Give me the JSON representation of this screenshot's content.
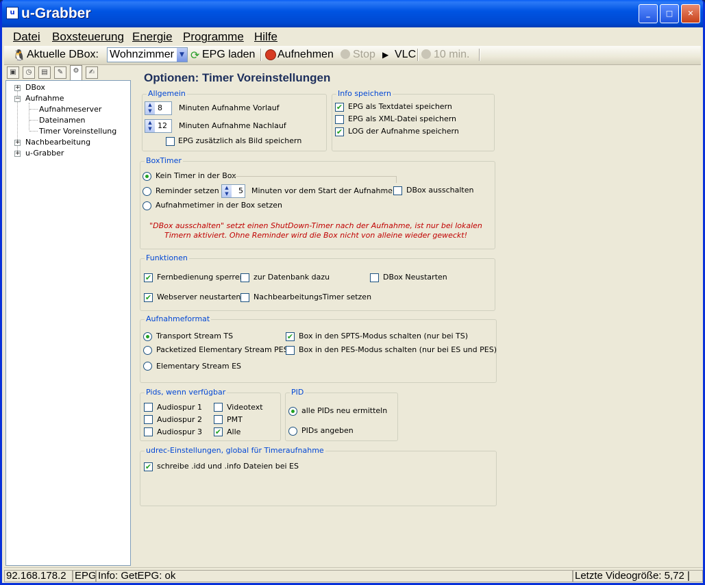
{
  "window": {
    "title": "u-Grabber"
  },
  "menu": [
    "Datei",
    "Boxsteuerung",
    "Energie",
    "Programme",
    "Hilfe"
  ],
  "toolbar": {
    "dbox_label": "Aktuelle DBox:",
    "dbox_value": "Wohnzimmer",
    "epg_load": "EPG laden",
    "record": "Aufnehmen",
    "stop": "Stop",
    "vlc": "VLC",
    "ten_min": "10 min."
  },
  "tree": {
    "dbox": "DBox",
    "aufnahme": "Aufnahme",
    "aufnahmeserver": "Aufnahmeserver",
    "dateinamen": "Dateinamen",
    "timer_voreinstellung": "Timer Voreinstellung",
    "nachbearbeitung": "Nachbearbeitung",
    "ugrabber": "u-Grabber"
  },
  "page_title": "Optionen: Timer Voreinstellungen",
  "allgemein": {
    "label": "Allgemein",
    "vorlauf_value": "8",
    "vorlauf_label": "Minuten Aufnahme Vorlauf",
    "nachlauf_value": "12",
    "nachlauf_label": "Minuten Aufnahme Nachlauf",
    "epg_bild": "EPG zusätzlich als Bild speichern"
  },
  "info": {
    "label": "Info speichern",
    "text": "EPG als Textdatei speichern",
    "xml": "EPG als XML-Datei speichern",
    "log": "LOG der Aufnahme speichern"
  },
  "boxtimer": {
    "label": "BoxTimer",
    "kein": "Kein Timer in der Box",
    "reminder": "Reminder setzen",
    "reminder_value": "5",
    "minuten": "Minuten vor dem Start der Aufnahme",
    "ausschalten": "DBox ausschalten",
    "aufnahmetimer": "Aufnahmetimer in der Box setzen",
    "note1": "\"DBox ausschalten\" setzt einen ShutDown-Timer nach der Aufnahme, ist nur bei lokalen",
    "note2": "Timern aktiviert. Ohne Reminder wird die Box nicht von alleine wieder geweckt!"
  },
  "funktionen": {
    "label": "Funktionen",
    "fernbedienung": "Fernbedienung sperren",
    "datenbank": "zur Datenbank dazu",
    "neustart": "DBox Neustarten",
    "webserver": "Webserver neustarten",
    "nachbearbeitungstimer": "NachbearbeitungsTimer setzen"
  },
  "aufnahmeformat": {
    "label": "Aufnahmeformat",
    "ts": "Transport Stream TS",
    "pes": "Packetized Elementary Stream PES",
    "es": "Elementary Stream ES",
    "spts": "Box in den SPTS-Modus schalten (nur bei TS)",
    "pesmode": "Box in den PES-Modus schalten (nur bei ES und PES)"
  },
  "pids": {
    "label": "Pids, wenn verfügbar",
    "a1": "Audiospur 1",
    "a2": "Audiospur 2",
    "a3": "Audiospur 3",
    "videotext": "Videotext",
    "pmt": "PMT",
    "alle": "Alle"
  },
  "pid": {
    "label": "PID",
    "neu": "alle PIDs neu ermitteln",
    "angeben": "PIDs angeben"
  },
  "udrec": {
    "label": "udrec-Einstellungen, global für Timeraufnahme",
    "idd": "schreibe .idd und .info Dateien bei ES"
  },
  "status": {
    "ip": "92.168.178.2",
    "epg": "EPG",
    "info": "Info: GetEPG: ok",
    "size": "Letzte Videogröße: 5,72 |"
  }
}
